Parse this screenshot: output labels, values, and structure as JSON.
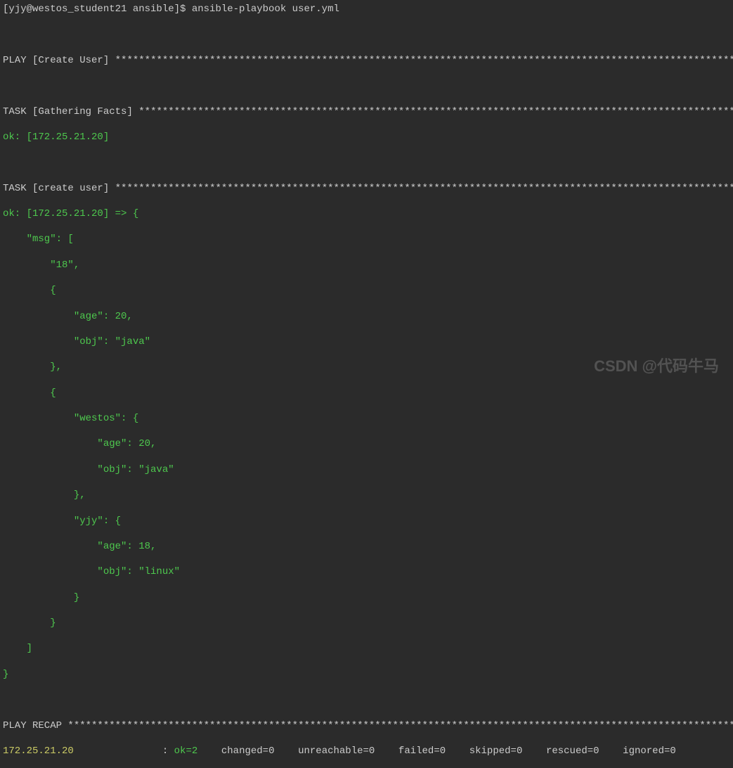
{
  "prompt": {
    "user_host": "[yjy@westos_student21 ansible]$ ",
    "command": "ansible-playbook user.yml"
  },
  "play_header_prefix": "PLAY [",
  "play_name": "Create User",
  "play_header_suffix": "] ",
  "task1_prefix": "TASK [",
  "task1_name": "Gathering Facts",
  "task1_suffix": "] ",
  "task1_result": "ok: [172.25.21.20]",
  "task2_prefix": "TASK [",
  "task2_name": "create user",
  "task2_suffix": "] ",
  "msg_header": "ok: [172.25.21.20] => {",
  "msg_line1": "    \"msg\": [",
  "msg_line2": "        \"18\",",
  "msg_line3": "        {",
  "msg_line4": "            \"age\": 20,",
  "msg_line5": "            \"obj\": \"java\"",
  "msg_line6": "        },",
  "msg_line7": "        {",
  "msg_line8": "            \"westos\": {",
  "msg_line9": "                \"age\": 20,",
  "msg_line10": "                \"obj\": \"java\"",
  "msg_line11": "            },",
  "msg_line12": "            \"yjy\": {",
  "msg_line13": "                \"age\": 18,",
  "msg_line14": "                \"obj\": \"linux\"",
  "msg_line15": "            }",
  "msg_line16": "        }",
  "msg_line17": "    ]",
  "msg_line18": "}",
  "recap_label": "PLAY RECAP ",
  "recap_host": "172.25.21.20",
  "recap_colon": "               : ",
  "recap_ok": "ok=2   ",
  "recap_changed": " changed=0    unreachable=0    failed=0    skipped=0    rescued=0    ignored=0",
  "stars_play": "*******************************************************************************************************************",
  "stars_task1": "************************************************************************************************************",
  "stars_task2": "***************************************************************************************************************",
  "stars_recap": "***********************************************************************************************************************",
  "watermark": "CSDN @代码牛马"
}
